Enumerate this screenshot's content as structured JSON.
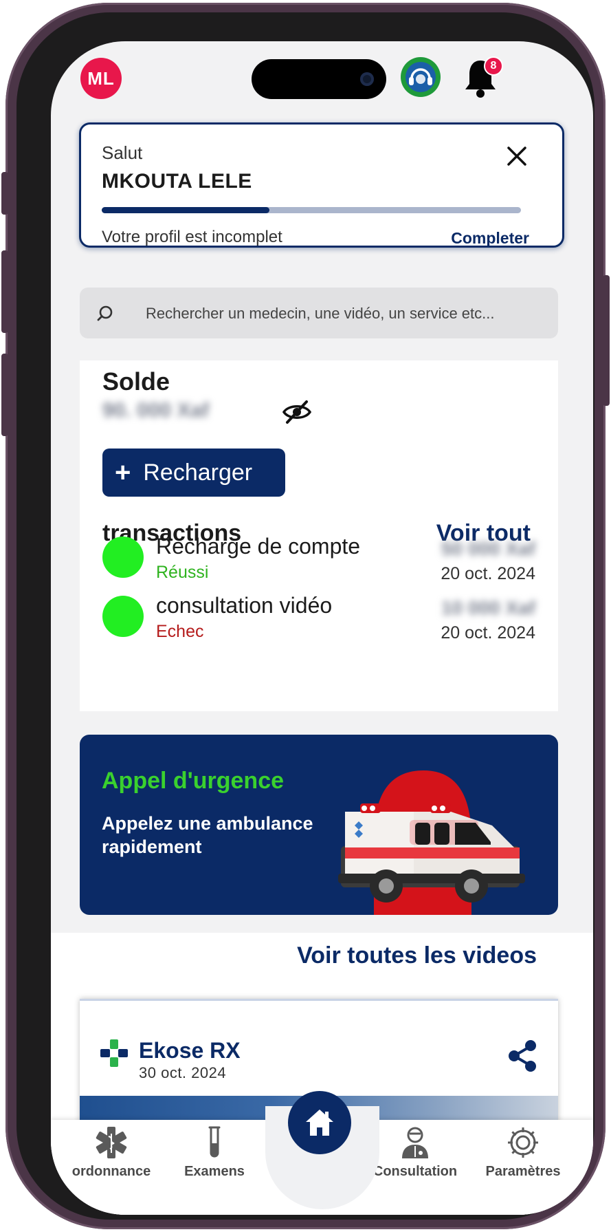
{
  "header": {
    "avatar_initials": "ML",
    "notification_count": "8",
    "icons": [
      "gift-icon",
      "support-headset-icon",
      "bell-icon"
    ]
  },
  "profile_card": {
    "greeting": "Salut",
    "name": "MKOUTA LELE",
    "progress": 0.4,
    "message": "Votre profil est incomplet",
    "action": "Completer"
  },
  "search": {
    "placeholder": "Rechercher un medecin, une vidéo, un service etc..."
  },
  "balance": {
    "title": "Solde",
    "amount_hidden": "90. 000 Xaf",
    "recharge_label": "Recharger"
  },
  "transactions": {
    "title": "transactions",
    "see_all": "Voir tout",
    "items": [
      {
        "label": "Recharge de compte",
        "status": "Réussi",
        "status_color": "#2fb31f",
        "amount": "50 000 Xaf",
        "date": "20 oct. 2024"
      },
      {
        "label": "consultation vidéo",
        "status": "Echec",
        "status_color": "#b51c1c",
        "amount": "10 000 Xaf",
        "date": "20 oct. 2024"
      }
    ]
  },
  "emergency": {
    "title": "Appel d'urgence",
    "subtitle": "Appelez une ambulance rapidement"
  },
  "videos": {
    "see_all": "Voir toutes les videos",
    "card": {
      "title": "Ekose RX",
      "date": "30 oct. 2024"
    }
  },
  "bottom_nav": {
    "items": [
      "ordonnance",
      "Examens",
      "Consultation",
      "Paramètres"
    ]
  },
  "colors": {
    "primary": "#0b2a66",
    "accent_green": "#3ad12e",
    "dot_green": "#22ee22",
    "avatar_red": "#e8174b"
  }
}
